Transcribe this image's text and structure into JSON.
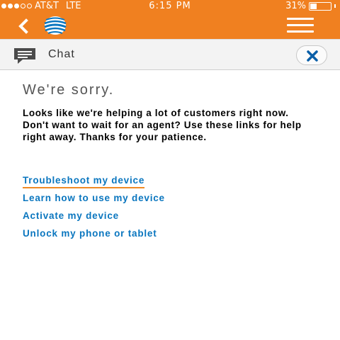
{
  "status_bar": {
    "carrier": "AT&T",
    "network": "LTE",
    "time": "6:15 PM",
    "battery_percent": "31%",
    "battery_level": 0.31,
    "signal_bars_filled": 3,
    "signal_bars_total": 5
  },
  "nav_bar": {
    "background_color": "#f08020",
    "back_icon": "chevron-left-icon",
    "logo": "att-globe-logo",
    "menu_icon": "hamburger-menu-icon"
  },
  "chat_header": {
    "title": "Chat",
    "chat_icon": "chat-bubble-icon",
    "close_icon": "close-icon"
  },
  "content": {
    "heading": "We're sorry.",
    "message": "Looks like we're helping a lot of customers right now. Don't want to wait for an agent? Use these links for help right away. Thanks for your patience.",
    "links": [
      "Troubleshoot my device",
      "Learn how to use my device",
      "Activate my device",
      "Unlock my phone or tablet"
    ],
    "link_color": "#0a76bf",
    "accent_color": "#f08a24"
  }
}
